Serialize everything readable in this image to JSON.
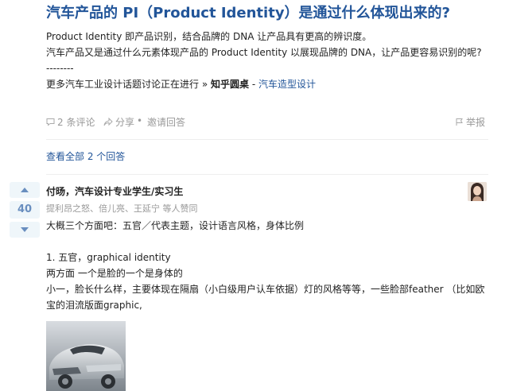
{
  "question": {
    "title": "汽车产品的 PI（Product Identity）是通过什么体现出来的?",
    "detail_lines": [
      "Product Identity 即产品识别，结合品牌的 DNA 让产品具有更高的辨识度。",
      "汽车产品又是通过什么元素体现产品的 Product Identity 以展现品牌的 DNA，让产品更容易识别的呢?",
      "--------"
    ],
    "roundtable_prefix": "更多汽车工业设计话题讨论正在进行 » ",
    "roundtable_name": "知乎圆桌",
    "roundtable_sep": " - ",
    "roundtable_link": "汽车造型设计"
  },
  "meta": {
    "comments": "2 条评论",
    "share": "分享",
    "dot": "•",
    "invite": "邀请回答",
    "report": "举报"
  },
  "view_all": "查看全部 2 个回答",
  "answer": {
    "vote_count": "40",
    "author": "付旸，汽车设计专业学生/实习生",
    "voters": "提利昂之怒、倍儿亮、王延宁 等人赞同",
    "lines": [
      "大概三个方面吧：五官／代表主题，设计语言风格，身体比例",
      "",
      "1. 五官，graphical identity",
      "两方面 一个是脸的一个是身体的",
      "小一，脸长什么样，主要体现在隔扇（小白级用户认车依据）灯的风格等等，一些脸部feather （比如欧宝的泪流版面graphic,"
    ]
  },
  "colors": {
    "link": "#225599",
    "vote_bg": "#eff6fa",
    "vote_fg": "#698ebf",
    "meta": "#999999"
  }
}
